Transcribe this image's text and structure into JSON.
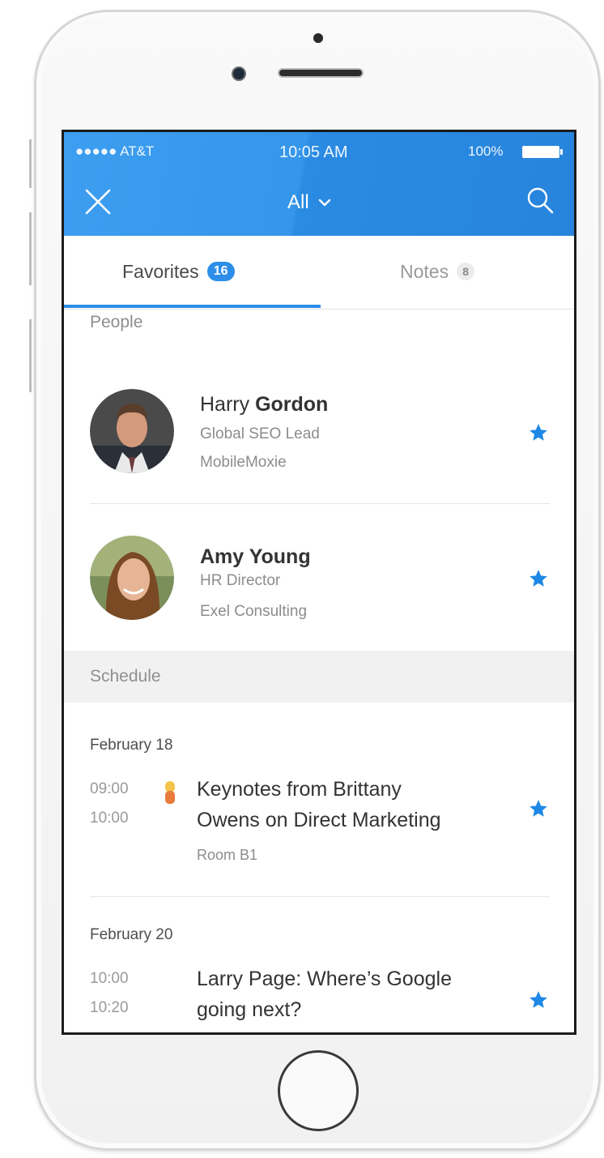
{
  "status_bar": {
    "carrier": "●●●●● AT&T",
    "time": "10:05 AM",
    "battery": "100%"
  },
  "header": {
    "filter_label": "All"
  },
  "tabs": [
    {
      "label": "Favorites",
      "count": "16",
      "active": true
    },
    {
      "label": "Notes",
      "count": "8",
      "active": false
    }
  ],
  "sections": {
    "people": "People",
    "schedule": "Schedule"
  },
  "people": [
    {
      "first": "Harry",
      "last": "Gordon",
      "title": "Global SEO Lead",
      "company": "MobileMoxie",
      "favorite": true
    },
    {
      "first": "Amy",
      "last": "Young",
      "title": "HR Director",
      "company": "Exel Consulting",
      "favorite": true
    }
  ],
  "schedule": [
    {
      "date": "February 18",
      "start": "09:00",
      "end": "10:00",
      "title_line1": "Keynotes from Brittany",
      "title_line2": "Owens on Direct Marketing",
      "room": "Room B1",
      "favorite": true
    },
    {
      "date": "February 20",
      "start": "10:00",
      "end": "10:20",
      "title_line1": "Larry Page: Where’s Google",
      "title_line2": "going next?",
      "favorite": true
    }
  ],
  "colors": {
    "accent": "#2c8ee8",
    "header_bg": "#3596ea",
    "star": "#1e88e5"
  }
}
